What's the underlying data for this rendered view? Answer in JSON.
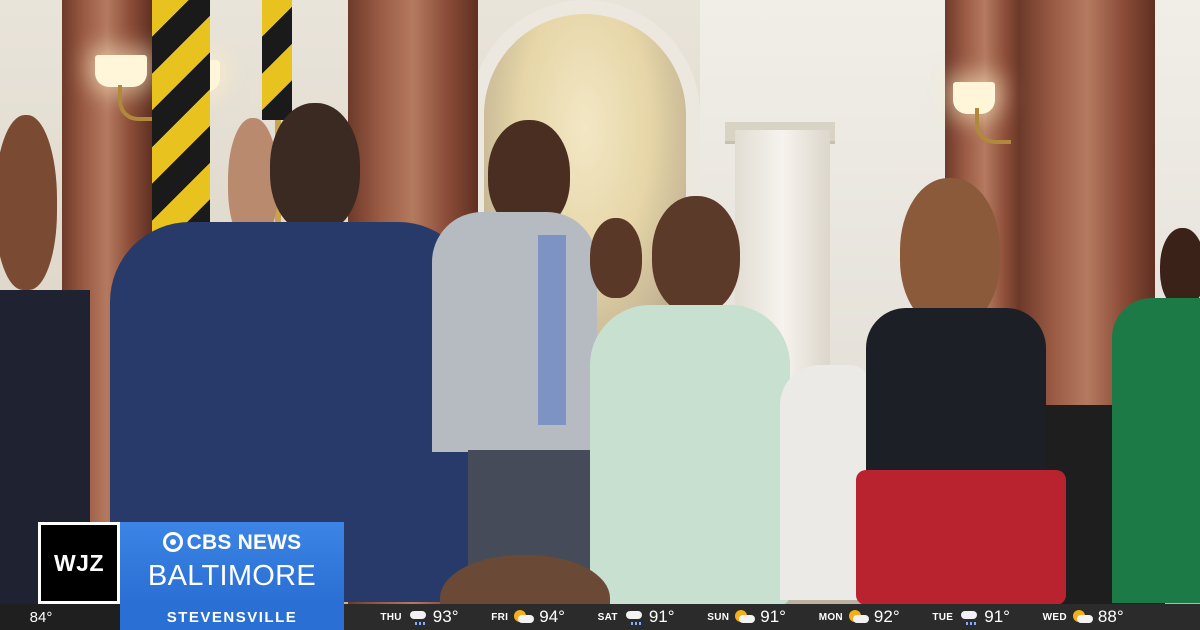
{
  "station": {
    "call_letters": "WJZ",
    "network": "CBS NEWS",
    "market": "BALTIMORE"
  },
  "ticker": {
    "current_temp": "84°",
    "location": "STEVENSVILLE",
    "forecast": [
      {
        "day": "THU",
        "icon": "rain-cloud-icon",
        "temp": "93°"
      },
      {
        "day": "FRI",
        "icon": "sun-cloud-icon",
        "temp": "94°"
      },
      {
        "day": "SAT",
        "icon": "rain-cloud-icon",
        "temp": "91°"
      },
      {
        "day": "SUN",
        "icon": "sun-cloud-icon",
        "temp": "91°"
      },
      {
        "day": "MON",
        "icon": "sun-cloud-icon",
        "temp": "92°"
      },
      {
        "day": "TUE",
        "icon": "rain-cloud-icon",
        "temp": "91°"
      },
      {
        "day": "WED",
        "icon": "sun-cloud-icon",
        "temp": "88°"
      }
    ]
  },
  "colors": {
    "brand_blue": "#2a6fd3",
    "ticker_bg": "#2b2b2b",
    "flag_gold": "#e8c21f"
  }
}
